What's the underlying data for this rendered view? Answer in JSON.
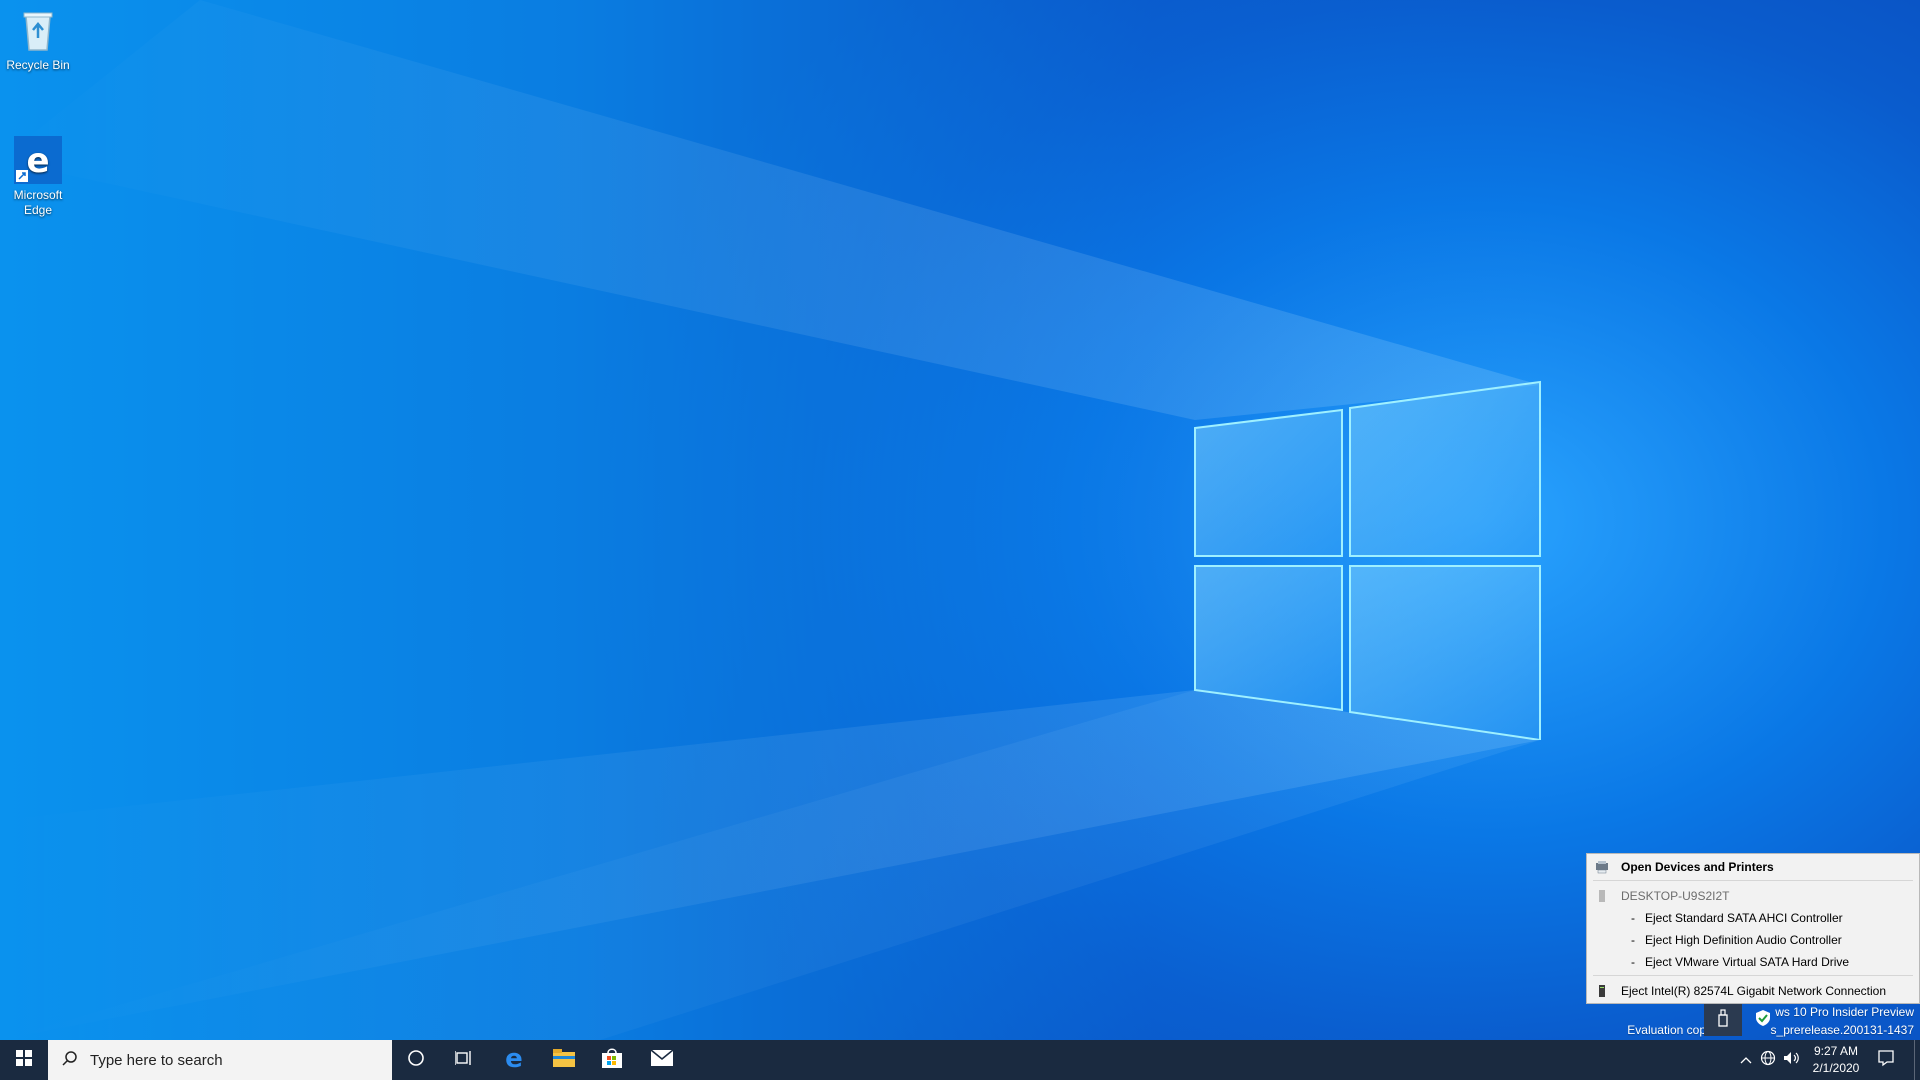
{
  "desktop": {
    "icons": [
      {
        "label": "Recycle Bin"
      },
      {
        "label": "Microsoft\nEdge"
      }
    ]
  },
  "watermark": {
    "line1": "ws 10 Pro Insider Preview",
    "line2_left": "Evaluation cop",
    "line2_right": "s_prerelease.200131-1437"
  },
  "tray_popup": {
    "open_devices": "Open Devices and Printers",
    "computer_name": "DESKTOP-U9S2I2T",
    "sub_items": [
      "Eject Standard SATA AHCI Controller",
      "Eject High Definition Audio Controller",
      "Eject VMware Virtual SATA Hard Drive"
    ],
    "network_item": "Eject Intel(R) 82574L Gigabit Network Connection"
  },
  "taskbar": {
    "search_placeholder": "Type here to search",
    "pinned": [
      "cortana-icon",
      "task-view-icon",
      "edge-icon",
      "file-explorer-icon",
      "store-icon",
      "mail-icon"
    ],
    "clock_time": "9:27 AM",
    "clock_date": "2/1/2020"
  },
  "colors": {
    "taskbar_bg": "#1a2a40",
    "desktop_blue": "#0a78e6",
    "popup_bg": "#f2f2f2"
  }
}
